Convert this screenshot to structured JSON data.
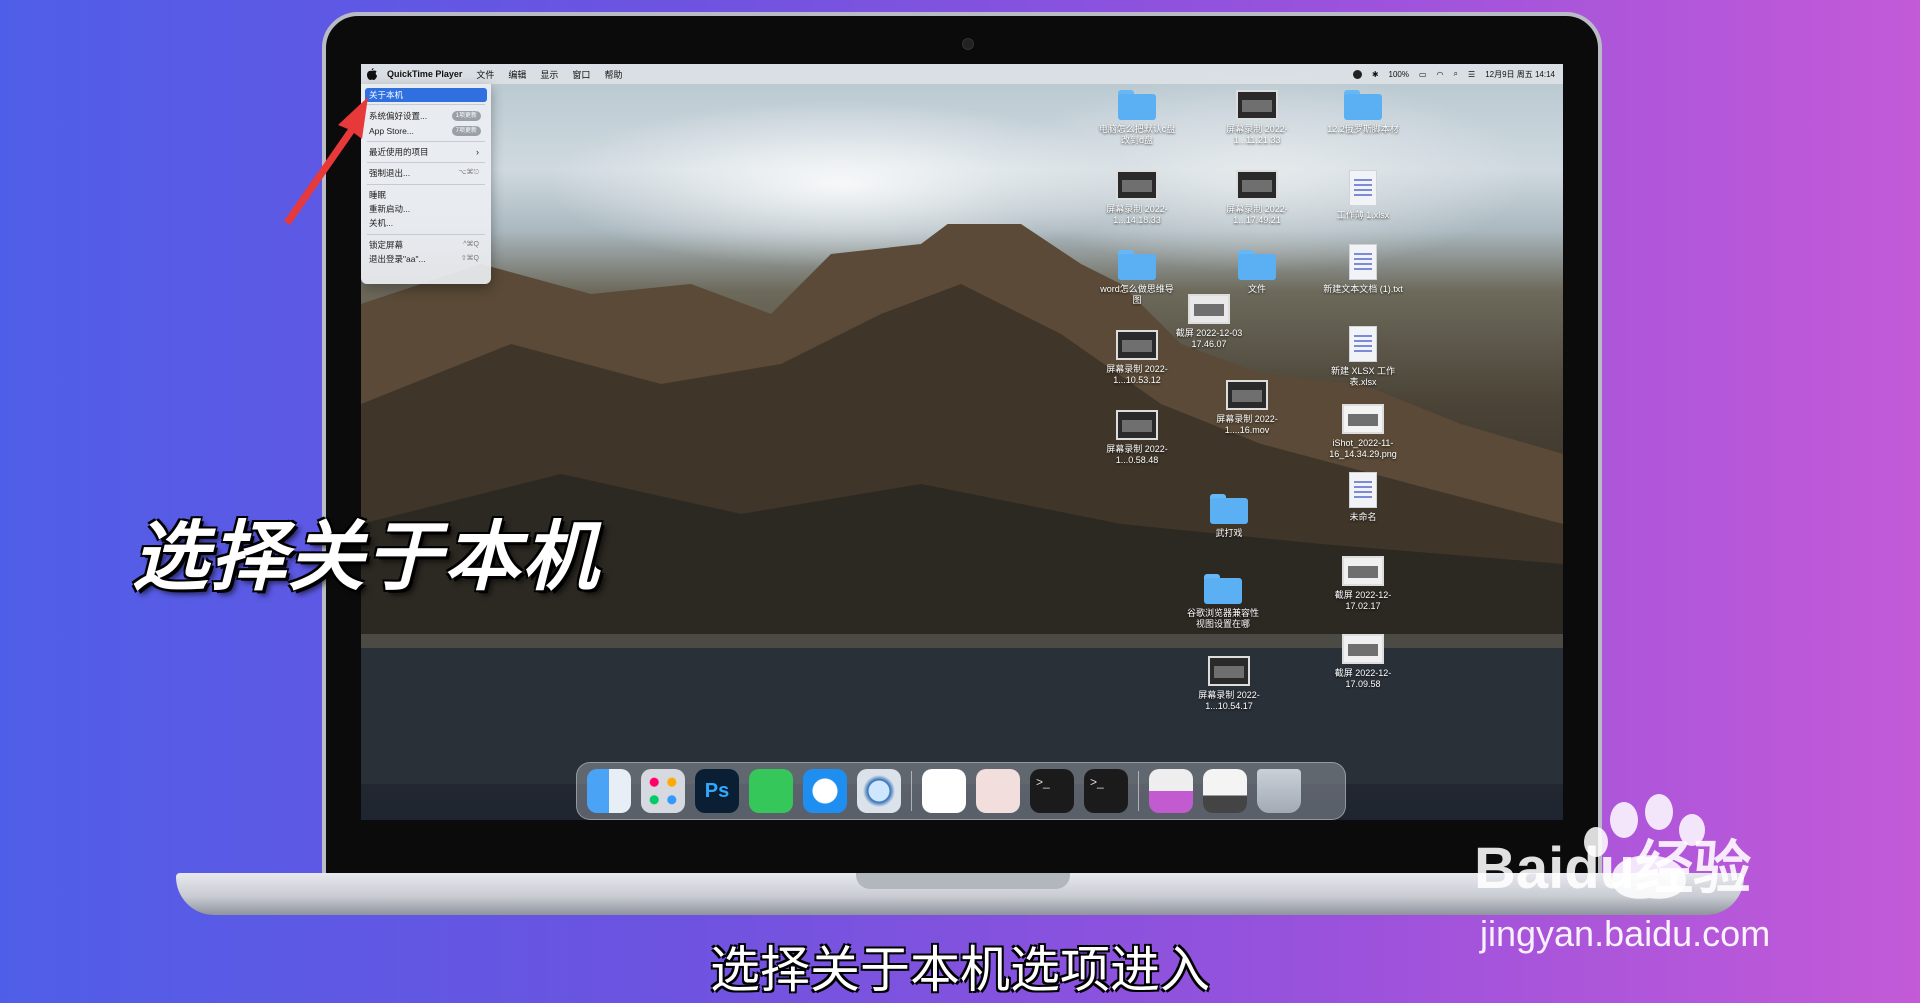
{
  "menubar": {
    "app_name": "QuickTime Player",
    "menus": [
      "文件",
      "编辑",
      "显示",
      "窗口",
      "帮助"
    ],
    "battery": "100%",
    "datetime": "12月9日 周五 14:14"
  },
  "apple_menu": {
    "items": [
      {
        "label": "关于本机"
      },
      {
        "label": "系统偏好设置...",
        "badge": "1项更新"
      },
      {
        "label": "App Store...",
        "badge": "7项更新"
      },
      {
        "label": "最近使用的项目",
        "shortcut": "›"
      },
      {
        "label": "强制退出...",
        "shortcut": "⌥⌘⎋"
      },
      {
        "label": "睡眠"
      },
      {
        "label": "重新启动..."
      },
      {
        "label": "关机..."
      },
      {
        "label": "锁定屏幕",
        "shortcut": "^⌘Q"
      },
      {
        "label": "退出登录\"aa\"...",
        "shortcut": "⇧⌘Q"
      }
    ]
  },
  "desktop": {
    "items": [
      "电脑怎么把默认c盘改到d盘",
      "屏幕录制 2022-1...11.21.33",
      "12.2俄罗斯脚本材",
      "屏幕录制 2022-1...14.18.33",
      "屏幕录制 2022-1...17.49.21",
      "工作薄 1.xlsx",
      "word怎么做思维导图",
      "文件",
      "新建文本文档 (1).txt",
      "截屏 2022-12-03 17.46.07",
      "屏幕录制 2022-1...10.53.12",
      "新建 XLSX 工作表.xlsx",
      "屏幕录制 2022-1....16.mov",
      "iShot_2022-11-16_14.34.29.png",
      "屏幕录制 2022-1...0.58.48",
      "武打戏",
      "未命名",
      "截屏 2022-12-17.02.17",
      "谷歌浏览器兼容性视图设置在哪",
      "截屏 2022-12-17.09.58",
      "屏幕录制 2022-1...10.54.17"
    ]
  },
  "dock": {
    "photoshop_label": "Ps",
    "terminal_label": ">_"
  },
  "overlay": {
    "title": "选择关于本机",
    "subtitle": "选择关于本机选项进入"
  },
  "watermark": {
    "url": "jingyan.baidu.com",
    "logo_text": "Baidu经验"
  },
  "colors": {
    "menu_highlight": "#2f6fe0",
    "folder_blue": "#5ab0f2",
    "arrow_red": "#e8393a"
  }
}
